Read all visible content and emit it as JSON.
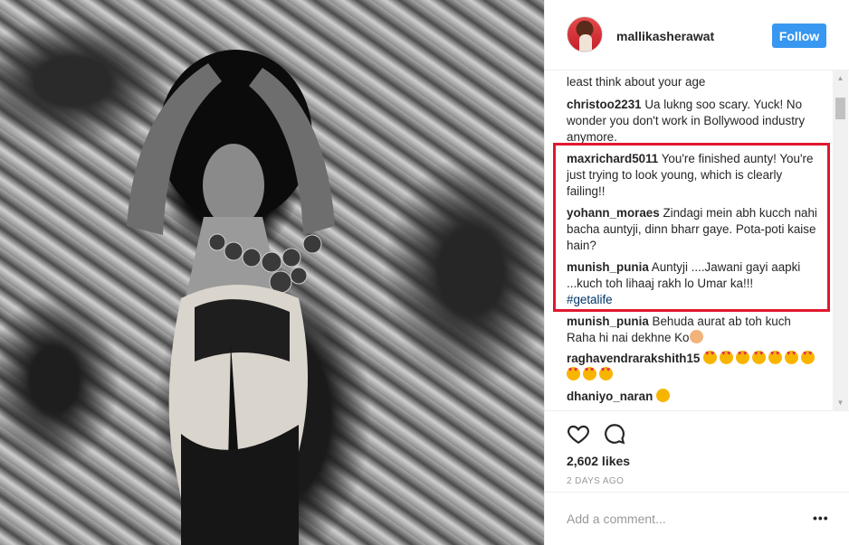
{
  "post": {
    "username": "mallikasherawat",
    "follow_label": "Follow",
    "likes": "2,602 likes",
    "timestamp": "2 DAYS AGO",
    "add_comment_placeholder": "Add a comment...",
    "more_label": "•••"
  },
  "comments": [
    {
      "user": "",
      "text": "least think about your age"
    },
    {
      "user": "christoo2231",
      "text": "Ua lukng soo scary. Yuck! No wonder you don't work in Bollywood industry anymore."
    },
    {
      "user": "maxrichard5011",
      "text": "You're finished aunty! You're just trying to look young, which is clearly failing!!"
    },
    {
      "user": "yohann_moraes",
      "text": "Zindagi mein abh kucch nahi bacha auntyji, dinn bharr gaye. Pota-poti kaise hain?"
    },
    {
      "user": "munish_punia",
      "text": "Auntyji ....Jawani gayi aapki ...kuch toh lihaaj rakh lo Umar ka!!!",
      "hashtag": "#getalife"
    },
    {
      "user": "munish_punia",
      "text": "Behuda aurat ab toh kuch Raha hi nai dekhne Ko"
    },
    {
      "user": "raghavendrarakshith15",
      "text": ""
    },
    {
      "user": "dhaniyo_naran",
      "text": ""
    }
  ],
  "icons": {
    "like": "heart-outline-icon",
    "comment": "speech-bubble-icon",
    "scroll_up": "scroll-up-arrow-icon",
    "scroll_down": "scroll-down-arrow-icon"
  },
  "colors": {
    "follow_button": "#3897f0",
    "highlight_border": "#e0182d",
    "hashtag": "#003569"
  }
}
